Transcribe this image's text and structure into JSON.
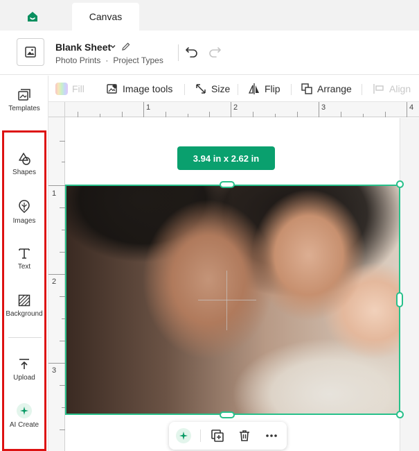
{
  "tabs": {
    "active": "Canvas"
  },
  "project": {
    "title": "Blank Sheet",
    "product": "Photo Prints",
    "type": "Project Types"
  },
  "sidebar": {
    "items": [
      {
        "label": "Templates",
        "icon": "templates-icon"
      },
      {
        "label": "Shapes",
        "icon": "shapes-icon"
      },
      {
        "label": "Images",
        "icon": "images-icon"
      },
      {
        "label": "Text",
        "icon": "text-icon"
      },
      {
        "label": "Background",
        "icon": "background-icon"
      },
      {
        "label": "Upload",
        "icon": "upload-icon"
      },
      {
        "label": "AI Create",
        "icon": "ai-sparkle-icon"
      }
    ],
    "highlight_color": "#dd1111"
  },
  "toolbar": {
    "fill": "Fill",
    "image_tools": "Image tools",
    "size": "Size",
    "flip": "Flip",
    "arrange": "Arrange",
    "align": "Align"
  },
  "ruler": {
    "top": [
      "1",
      "2",
      "3",
      "4"
    ],
    "left": [
      "1",
      "2",
      "3"
    ]
  },
  "canvas": {
    "dimensions": "3.94  in x 2.62  in",
    "accent": "#0aa06e",
    "selection_color": "#27c08a"
  }
}
